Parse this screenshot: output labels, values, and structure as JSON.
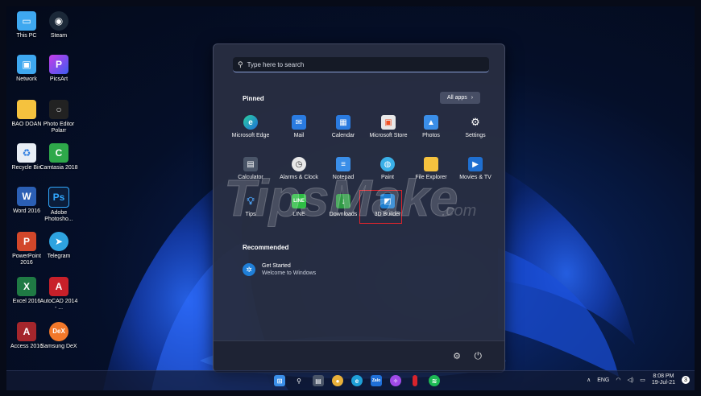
{
  "desktop_icons": [
    {
      "label": "This PC",
      "icon": "monitor-icon",
      "color": "#3ea8f0"
    },
    {
      "label": "Steam",
      "icon": "steam-icon",
      "color": "#1b2838"
    },
    {
      "label": "Network",
      "icon": "network-icon",
      "color": "#3ea8f0"
    },
    {
      "label": "PicsArt",
      "icon": "picsart-icon",
      "color": "#8a3cf0"
    },
    {
      "label": "BAO DOAN",
      "icon": "folder-icon",
      "color": "#f5c23e"
    },
    {
      "label": "Photo Editor Polarr",
      "icon": "polarr-icon",
      "color": "#222222"
    },
    {
      "label": "Recycle Bin",
      "icon": "recycle-bin-icon",
      "color": "#e8eef5"
    },
    {
      "label": "Camtasia 2018",
      "icon": "camtasia-icon",
      "color": "#2ea84a"
    },
    {
      "label": "Word 2016",
      "icon": "word-icon",
      "color": "#2b5fb4"
    },
    {
      "label": "Adobe Photosho...",
      "icon": "photoshop-icon",
      "color": "#0b1d3a"
    },
    {
      "label": "PowerPoint 2016",
      "icon": "powerpoint-icon",
      "color": "#d2472a"
    },
    {
      "label": "Telegram",
      "icon": "telegram-icon",
      "color": "#2ea3e0"
    },
    {
      "label": "Excel 2016",
      "icon": "excel-icon",
      "color": "#1f7a44"
    },
    {
      "label": "AutoCAD 2014 - ...",
      "icon": "autocad-icon",
      "color": "#c8202a"
    },
    {
      "label": "Access 2016",
      "icon": "access-icon",
      "color": "#a4262c"
    },
    {
      "label": "Samsung DeX",
      "icon": "samsung-dex-icon",
      "color": "#f2782a"
    }
  ],
  "start_menu": {
    "search_placeholder": "Type here to search",
    "pinned_title": "Pinned",
    "all_apps_label": "All apps",
    "pinned_apps": [
      {
        "label": "Microsoft Edge",
        "icon": "edge-icon",
        "color": "#1fa0d8"
      },
      {
        "label": "Mail",
        "icon": "mail-icon",
        "color": "#2a7be0"
      },
      {
        "label": "Calendar",
        "icon": "calendar-icon",
        "color": "#2a7be0"
      },
      {
        "label": "Microsoft Store",
        "icon": "store-icon",
        "color": "#e8e8e8"
      },
      {
        "label": "Photos",
        "icon": "photos-icon",
        "color": "#3a8ee8"
      },
      {
        "label": "Settings",
        "icon": "gear-icon",
        "color": "#7a8599"
      },
      {
        "label": "Calculator",
        "icon": "calculator-icon",
        "color": "#4a5568"
      },
      {
        "label": "Alarms & Clock",
        "icon": "clock-icon",
        "color": "#e8e8e8"
      },
      {
        "label": "Notepad",
        "icon": "notepad-icon",
        "color": "#3a8ee8"
      },
      {
        "label": "Paint",
        "icon": "paint-icon",
        "color": "#3ab0e8"
      },
      {
        "label": "File Explorer",
        "icon": "folder-icon",
        "color": "#f5c23e"
      },
      {
        "label": "Movies & TV",
        "icon": "movies-icon",
        "color": "#1f6fd0"
      },
      {
        "label": "Tips",
        "icon": "tips-icon",
        "color": "#4a9ae8"
      },
      {
        "label": "LINE",
        "icon": "line-icon",
        "color": "#2ebd44"
      },
      {
        "label": "Downloads",
        "icon": "downloads-icon",
        "color": "#2e9a44"
      },
      {
        "label": "3D Builder",
        "icon": "3d-builder-icon",
        "color": "#1f7fd0"
      }
    ],
    "recommended_title": "Recommended",
    "recommended": [
      {
        "title": "Get Started",
        "subtitle": "Welcome to Windows",
        "icon": "get-started-icon"
      }
    ]
  },
  "watermark_text": "TipsMake",
  "watermark_suffix": ".com",
  "taskbar": {
    "tray_lang": "ENG",
    "time": "8:08 PM",
    "date": "19-Jul-21",
    "notification_count": "3"
  },
  "colors": {
    "accent": "#3a8ee8",
    "highlight": "#e0242c",
    "menu_bg": "#282e42"
  }
}
